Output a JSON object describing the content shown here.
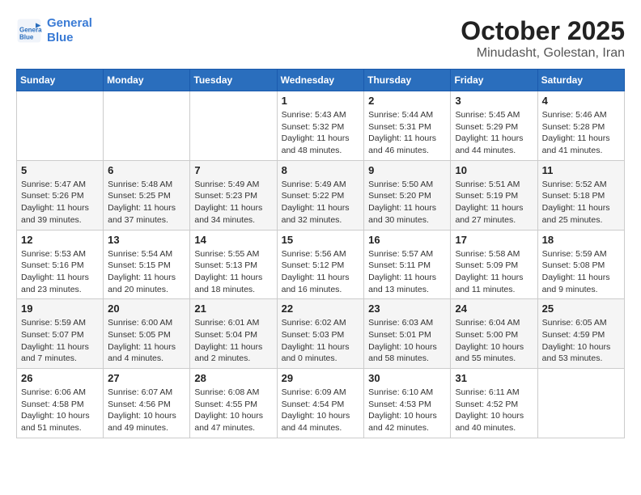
{
  "logo": {
    "line1": "General",
    "line2": "Blue"
  },
  "header": {
    "month": "October 2025",
    "location": "Minudasht, Golestan, Iran"
  },
  "weekdays": [
    "Sunday",
    "Monday",
    "Tuesday",
    "Wednesday",
    "Thursday",
    "Friday",
    "Saturday"
  ],
  "weeks": [
    [
      {
        "day": "",
        "info": ""
      },
      {
        "day": "",
        "info": ""
      },
      {
        "day": "",
        "info": ""
      },
      {
        "day": "1",
        "info": "Sunrise: 5:43 AM\nSunset: 5:32 PM\nDaylight: 11 hours and 48 minutes."
      },
      {
        "day": "2",
        "info": "Sunrise: 5:44 AM\nSunset: 5:31 PM\nDaylight: 11 hours and 46 minutes."
      },
      {
        "day": "3",
        "info": "Sunrise: 5:45 AM\nSunset: 5:29 PM\nDaylight: 11 hours and 44 minutes."
      },
      {
        "day": "4",
        "info": "Sunrise: 5:46 AM\nSunset: 5:28 PM\nDaylight: 11 hours and 41 minutes."
      }
    ],
    [
      {
        "day": "5",
        "info": "Sunrise: 5:47 AM\nSunset: 5:26 PM\nDaylight: 11 hours and 39 minutes."
      },
      {
        "day": "6",
        "info": "Sunrise: 5:48 AM\nSunset: 5:25 PM\nDaylight: 11 hours and 37 minutes."
      },
      {
        "day": "7",
        "info": "Sunrise: 5:49 AM\nSunset: 5:23 PM\nDaylight: 11 hours and 34 minutes."
      },
      {
        "day": "8",
        "info": "Sunrise: 5:49 AM\nSunset: 5:22 PM\nDaylight: 11 hours and 32 minutes."
      },
      {
        "day": "9",
        "info": "Sunrise: 5:50 AM\nSunset: 5:20 PM\nDaylight: 11 hours and 30 minutes."
      },
      {
        "day": "10",
        "info": "Sunrise: 5:51 AM\nSunset: 5:19 PM\nDaylight: 11 hours and 27 minutes."
      },
      {
        "day": "11",
        "info": "Sunrise: 5:52 AM\nSunset: 5:18 PM\nDaylight: 11 hours and 25 minutes."
      }
    ],
    [
      {
        "day": "12",
        "info": "Sunrise: 5:53 AM\nSunset: 5:16 PM\nDaylight: 11 hours and 23 minutes."
      },
      {
        "day": "13",
        "info": "Sunrise: 5:54 AM\nSunset: 5:15 PM\nDaylight: 11 hours and 20 minutes."
      },
      {
        "day": "14",
        "info": "Sunrise: 5:55 AM\nSunset: 5:13 PM\nDaylight: 11 hours and 18 minutes."
      },
      {
        "day": "15",
        "info": "Sunrise: 5:56 AM\nSunset: 5:12 PM\nDaylight: 11 hours and 16 minutes."
      },
      {
        "day": "16",
        "info": "Sunrise: 5:57 AM\nSunset: 5:11 PM\nDaylight: 11 hours and 13 minutes."
      },
      {
        "day": "17",
        "info": "Sunrise: 5:58 AM\nSunset: 5:09 PM\nDaylight: 11 hours and 11 minutes."
      },
      {
        "day": "18",
        "info": "Sunrise: 5:59 AM\nSunset: 5:08 PM\nDaylight: 11 hours and 9 minutes."
      }
    ],
    [
      {
        "day": "19",
        "info": "Sunrise: 5:59 AM\nSunset: 5:07 PM\nDaylight: 11 hours and 7 minutes."
      },
      {
        "day": "20",
        "info": "Sunrise: 6:00 AM\nSunset: 5:05 PM\nDaylight: 11 hours and 4 minutes."
      },
      {
        "day": "21",
        "info": "Sunrise: 6:01 AM\nSunset: 5:04 PM\nDaylight: 11 hours and 2 minutes."
      },
      {
        "day": "22",
        "info": "Sunrise: 6:02 AM\nSunset: 5:03 PM\nDaylight: 11 hours and 0 minutes."
      },
      {
        "day": "23",
        "info": "Sunrise: 6:03 AM\nSunset: 5:01 PM\nDaylight: 10 hours and 58 minutes."
      },
      {
        "day": "24",
        "info": "Sunrise: 6:04 AM\nSunset: 5:00 PM\nDaylight: 10 hours and 55 minutes."
      },
      {
        "day": "25",
        "info": "Sunrise: 6:05 AM\nSunset: 4:59 PM\nDaylight: 10 hours and 53 minutes."
      }
    ],
    [
      {
        "day": "26",
        "info": "Sunrise: 6:06 AM\nSunset: 4:58 PM\nDaylight: 10 hours and 51 minutes."
      },
      {
        "day": "27",
        "info": "Sunrise: 6:07 AM\nSunset: 4:56 PM\nDaylight: 10 hours and 49 minutes."
      },
      {
        "day": "28",
        "info": "Sunrise: 6:08 AM\nSunset: 4:55 PM\nDaylight: 10 hours and 47 minutes."
      },
      {
        "day": "29",
        "info": "Sunrise: 6:09 AM\nSunset: 4:54 PM\nDaylight: 10 hours and 44 minutes."
      },
      {
        "day": "30",
        "info": "Sunrise: 6:10 AM\nSunset: 4:53 PM\nDaylight: 10 hours and 42 minutes."
      },
      {
        "day": "31",
        "info": "Sunrise: 6:11 AM\nSunset: 4:52 PM\nDaylight: 10 hours and 40 minutes."
      },
      {
        "day": "",
        "info": ""
      }
    ]
  ]
}
